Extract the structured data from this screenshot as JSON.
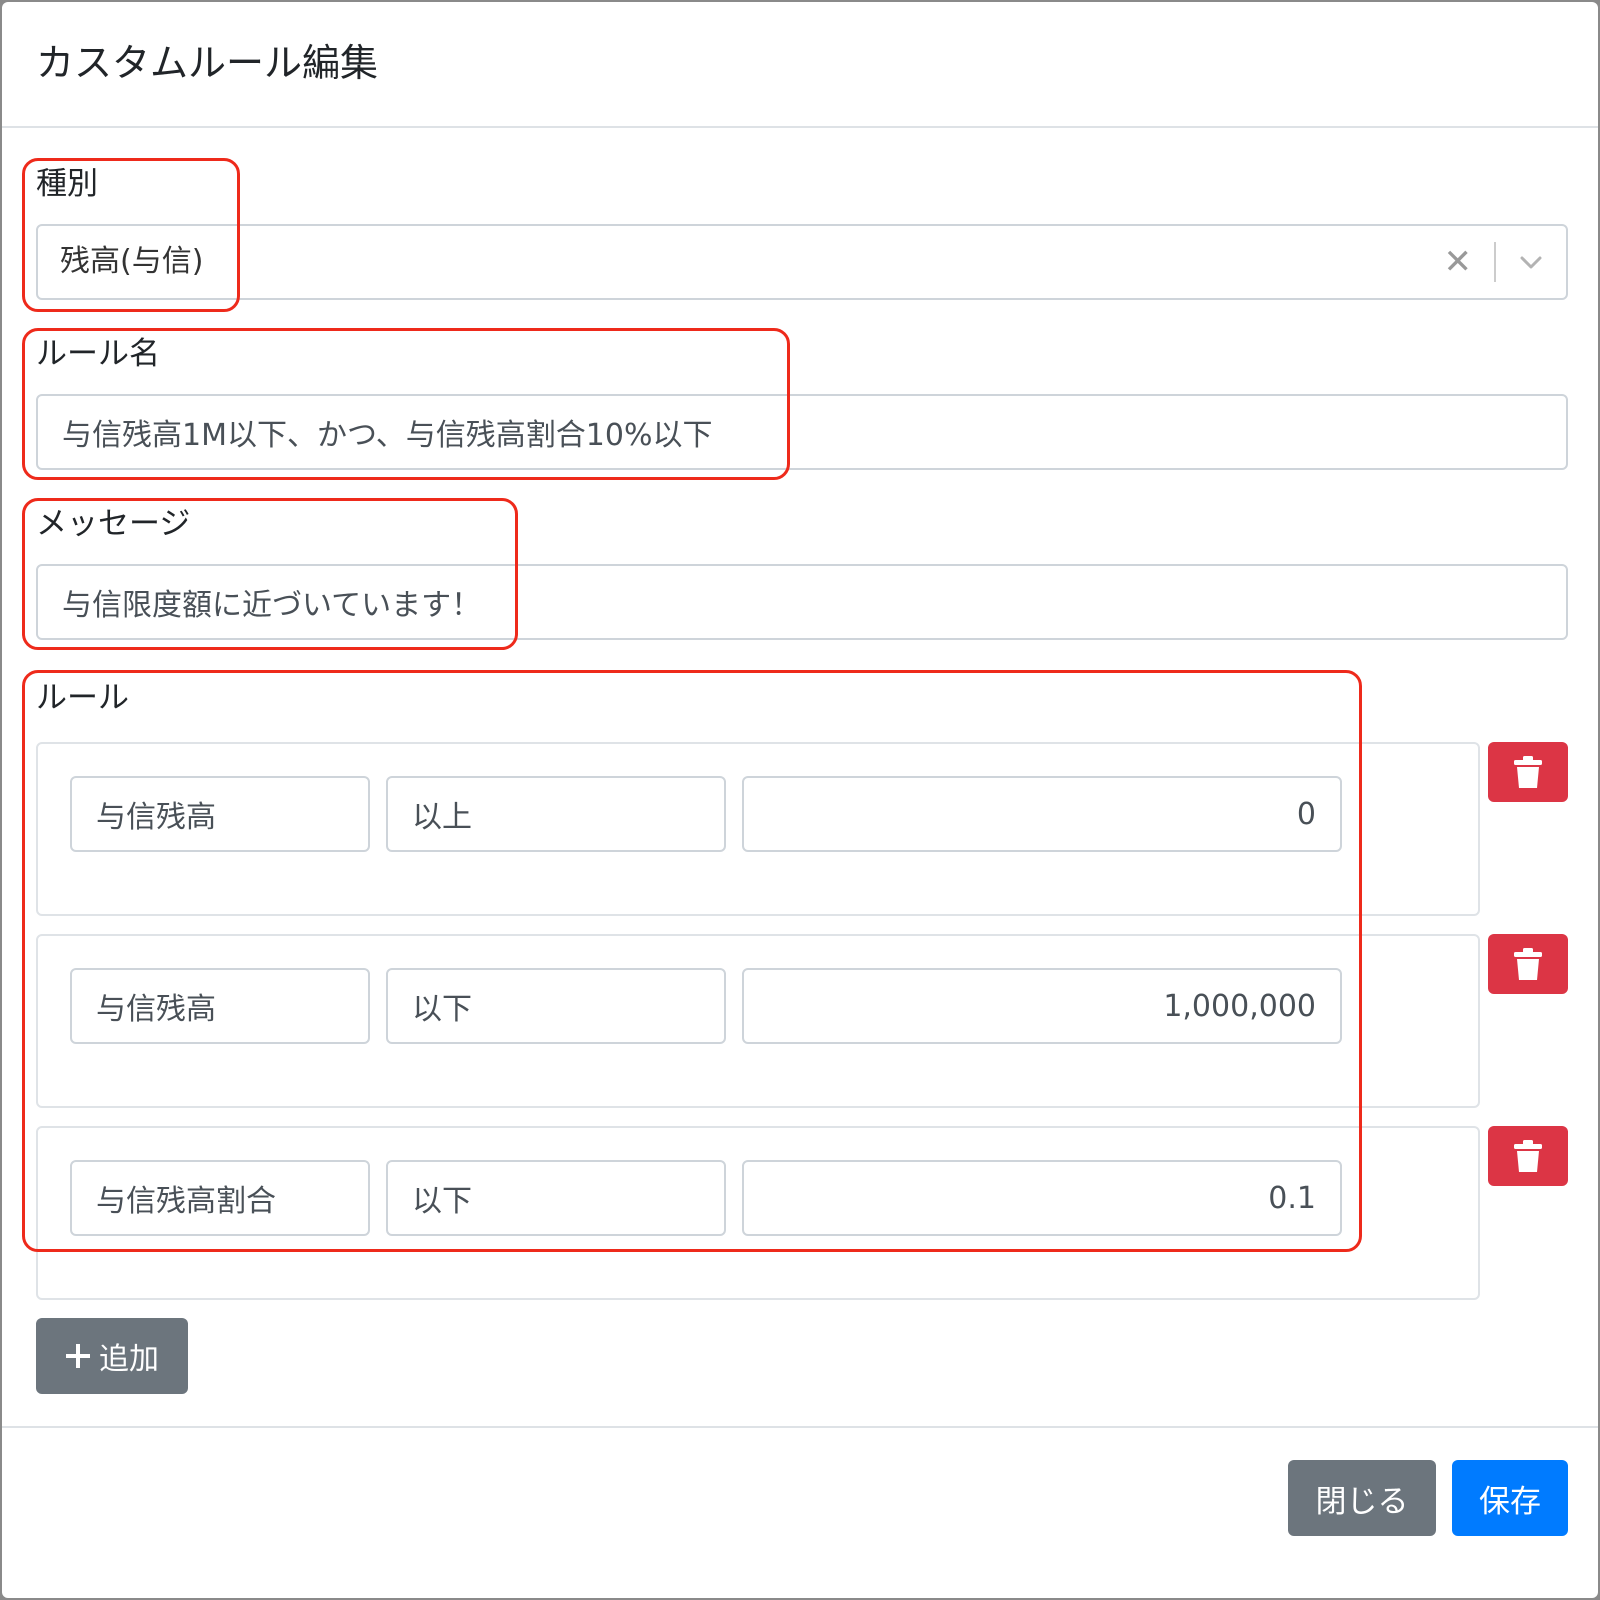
{
  "dialog": {
    "title": "カスタムルール編集"
  },
  "type_field": {
    "label": "種別",
    "value": "残高(与信)",
    "clear_icon": "x-icon",
    "dropdown_icon": "chevron-down-icon"
  },
  "name_field": {
    "label": "ルール名",
    "value": "与信残高1M以下、かつ、与信残高割合10%以下"
  },
  "message_field": {
    "label": "メッセージ",
    "value": "与信限度額に近づいています！"
  },
  "rules": {
    "label": "ルール",
    "items": [
      {
        "metric": "与信残高",
        "operator": "以上",
        "value": "0"
      },
      {
        "metric": "与信残高",
        "operator": "以下",
        "value": "1,000,000"
      },
      {
        "metric": "与信残高割合",
        "operator": "以下",
        "value": "0.1"
      }
    ],
    "delete_icon": "trash-icon",
    "add_label": "追加",
    "add_icon": "plus-icon"
  },
  "footer": {
    "close_label": "閉じる",
    "save_label": "保存"
  },
  "colors": {
    "danger": "#dc3545",
    "secondary": "#6c757d",
    "primary": "#007bff",
    "highlight": "#ee2a1b"
  }
}
